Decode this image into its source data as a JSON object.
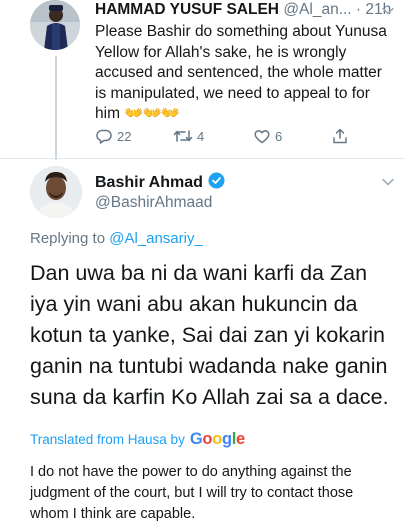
{
  "reply_tweet": {
    "name": "HAMMAD YUSUF SALEH",
    "meta": "@Al_an... · 21h",
    "text": "Please Bashir do something about Yunusa Yellow for Allah's sake, he is wrongly accused and sentenced, the whole matter is manipulated, we need to appeal to for him",
    "emoji": "👐👐👐",
    "stats": {
      "replies": "22",
      "retweets": "4",
      "likes": "6"
    }
  },
  "main_tweet": {
    "name": "Bashir Ahmad",
    "handle": "@BashirAhmaad",
    "replying_label": "Replying to",
    "replying_handle": "@Al_ansariy_",
    "text": "Dan uwa ba ni da wani karfi da Zan iya yin wani abu akan hukuncin da kotun ta yanke, Sai dai zan yi kokarin ganin na tuntubi wadanda nake ganin suna da karfin Ko Allah zai sa a dace.",
    "translated_label": "Translated from Hausa by",
    "google_letters": [
      "G",
      "o",
      "o",
      "g",
      "l",
      "e"
    ],
    "translation": "I do not have the power to do anything against the judgment of the court, but I will try to contact those whom I think are capable."
  },
  "colors": {
    "link": "#1da1f2",
    "secondary_text": "#657786",
    "primary_text": "#14171a",
    "divider": "#e1e8ed",
    "google": [
      "#4285f4",
      "#ea4335",
      "#fbbc05",
      "#4285f4",
      "#34a853",
      "#ea4335"
    ]
  },
  "icons": [
    "reply-icon",
    "retweet-icon",
    "like-icon",
    "share-icon",
    "chevron-down-icon",
    "verified-badge-icon"
  ]
}
